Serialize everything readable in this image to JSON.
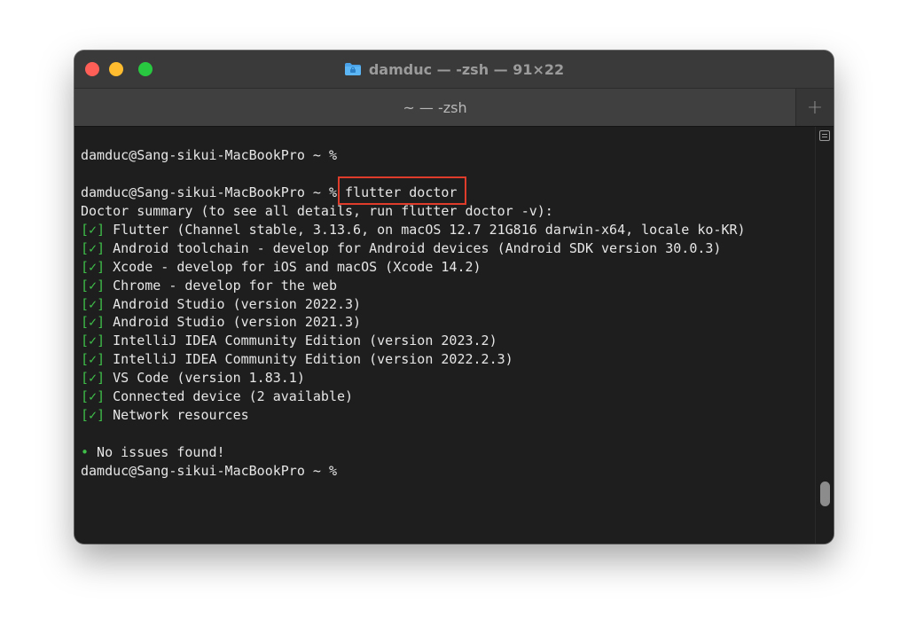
{
  "window": {
    "title": "damduc — -zsh — 91×22",
    "folder_icon": "folder-icon"
  },
  "tabs": [
    {
      "label": "~ — -zsh"
    }
  ],
  "new_tab_label": "+",
  "terminal": {
    "lines": [
      {
        "prefix": "",
        "text": "damduc@Sang-sikui-MacBookPro ~ %"
      },
      {
        "prefix": "",
        "text": ""
      },
      {
        "prefix": "",
        "text": "damduc@Sang-sikui-MacBookPro ~ % flutter doctor"
      },
      {
        "prefix": "",
        "text": "Doctor summary (to see all details, run flutter doctor -v):"
      },
      {
        "prefix": "[✓]",
        "text": " Flutter (Channel stable, 3.13.6, on macOS 12.7 21G816 darwin-x64, locale ko-KR)"
      },
      {
        "prefix": "[✓]",
        "text": " Android toolchain - develop for Android devices (Android SDK version 30.0.3)"
      },
      {
        "prefix": "[✓]",
        "text": " Xcode - develop for iOS and macOS (Xcode 14.2)"
      },
      {
        "prefix": "[✓]",
        "text": " Chrome - develop for the web"
      },
      {
        "prefix": "[✓]",
        "text": " Android Studio (version 2022.3)"
      },
      {
        "prefix": "[✓]",
        "text": " Android Studio (version 2021.3)"
      },
      {
        "prefix": "[✓]",
        "text": " IntelliJ IDEA Community Edition (version 2023.2)"
      },
      {
        "prefix": "[✓]",
        "text": " IntelliJ IDEA Community Edition (version 2022.2.3)"
      },
      {
        "prefix": "[✓]",
        "text": " VS Code (version 1.83.1)"
      },
      {
        "prefix": "[✓]",
        "text": " Connected device (2 available)"
      },
      {
        "prefix": "[✓]",
        "text": " Network resources"
      },
      {
        "prefix": "",
        "text": ""
      },
      {
        "prefix": "•",
        "text": " No issues found!"
      },
      {
        "prefix": "",
        "text": "damduc@Sang-sikui-MacBookPro ~ %"
      }
    ]
  },
  "colors": {
    "check": "#3fbf4a",
    "highlight_border": "#e03c2b",
    "background": "#1e1e1e",
    "text": "#e6e6e6"
  }
}
